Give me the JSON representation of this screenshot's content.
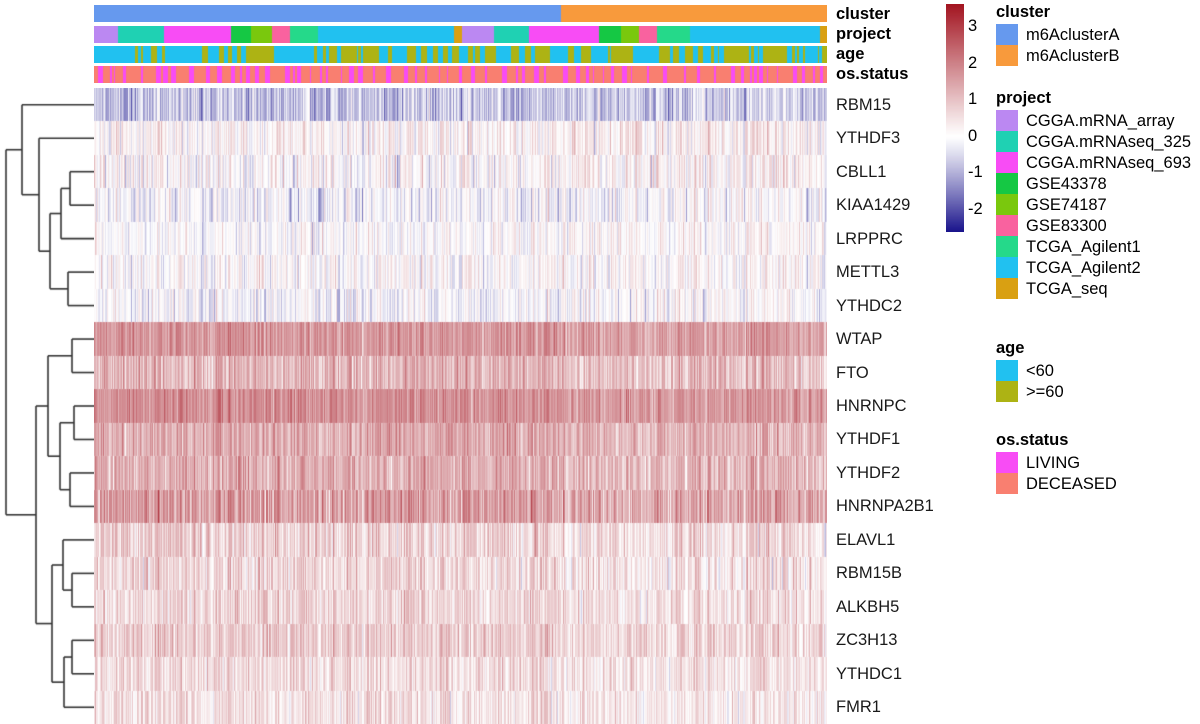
{
  "annotation_titles": [
    "cluster",
    "project",
    "age",
    "os.status"
  ],
  "row_labels": [
    "RBM15",
    "YTHDF3",
    "CBLL1",
    "KIAA1429",
    "LRPPRC",
    "METTL3",
    "YTHDC2",
    "WTAP",
    "FTO",
    "HNRNPC",
    "YTHDF1",
    "YTHDF2",
    "HNRNPA2B1",
    "ELAVL1",
    "RBM15B",
    "ALKBH5",
    "ZC3H13",
    "YTHDC1",
    "FMR1"
  ],
  "colorbar": {
    "ticks": [
      "3",
      "2",
      "1",
      "0",
      "-1",
      "-2"
    ],
    "tick_values": [
      3,
      2,
      1,
      0,
      -1,
      -2
    ],
    "vmin": -2.6,
    "vmax": 3.6,
    "low_color": "#1a148c",
    "mid_color": "#ffffff",
    "high_color": "#a31521"
  },
  "legends": [
    {
      "title": "cluster",
      "items": [
        {
          "label": "m6AclusterA",
          "color": "#6699ee"
        },
        {
          "label": "m6AclusterB",
          "color": "#f89a3c"
        }
      ]
    },
    {
      "title": "project",
      "items": [
        {
          "label": "CGGA.mRNA_array",
          "color": "#bb88f2"
        },
        {
          "label": "CGGA.mRNAseq_325",
          "color": "#1fd1b3"
        },
        {
          "label": "CGGA.mRNAseq_693",
          "color": "#f84cf5"
        },
        {
          "label": "GSE43378",
          "color": "#15c844"
        },
        {
          "label": "GSE74187",
          "color": "#7ac80d"
        },
        {
          "label": "GSE83300",
          "color": "#f9629f"
        },
        {
          "label": "TCGA_Agilent1",
          "color": "#25d98a"
        },
        {
          "label": "TCGA_Agilent2",
          "color": "#21c1f0"
        },
        {
          "label": "TCGA_seq",
          "color": "#d9a012"
        }
      ]
    },
    {
      "title": "age",
      "items": [
        {
          "label": "<60",
          "color": "#21c1f0"
        },
        {
          "label": ">=60",
          "color": "#adb314"
        }
      ]
    },
    {
      "title": "os.status",
      "items": [
        {
          "label": "LIVING",
          "color": "#f84cf5"
        },
        {
          "label": "DECEASED",
          "color": "#f97f70"
        }
      ]
    }
  ],
  "chart_data": {
    "type": "heatmap",
    "title": "",
    "xlabel": "",
    "ylabel": "",
    "colorbar_label": "",
    "rows": [
      "RBM15",
      "YTHDF3",
      "CBLL1",
      "KIAA1429",
      "LRPPRC",
      "METTL3",
      "YTHDC2",
      "WTAP",
      "FTO",
      "HNRNPC",
      "YTHDF1",
      "YTHDF2",
      "HNRNPA2B1",
      "ELAVL1",
      "RBM15B",
      "ALKBH5",
      "ZC3H13",
      "YTHDC1",
      "FMR1"
    ],
    "n_columns": 733,
    "zlim": [
      -2.6,
      3.6
    ],
    "grid": false,
    "legend_position": "right",
    "row_dendrogram": true,
    "column_dendrogram": false,
    "row_mean_values": [
      -0.75,
      0.22,
      0.1,
      -0.12,
      0.02,
      0.05,
      -0.1,
      1.55,
      1.05,
      1.7,
      1.25,
      1.2,
      1.45,
      0.62,
      0.55,
      0.58,
      0.7,
      0.48,
      0.4
    ],
    "row_spread_values": [
      0.55,
      0.55,
      0.6,
      0.55,
      0.45,
      0.5,
      0.5,
      0.42,
      0.55,
      0.42,
      0.5,
      0.5,
      0.6,
      0.55,
      0.55,
      0.5,
      0.5,
      0.5,
      0.48
    ],
    "cluster_split_column": 467,
    "column_annotations": {
      "cluster": {
        "segments": [
          {
            "label": "m6AclusterA",
            "start": 0,
            "end": 467
          },
          {
            "label": "m6AclusterB",
            "start": 467,
            "end": 733
          }
        ]
      },
      "project": {
        "segments": [
          {
            "label": "CGGA.mRNA_array",
            "start": 0,
            "end": 24
          },
          {
            "label": "CGGA.mRNAseq_325",
            "start": 24,
            "end": 70
          },
          {
            "label": "CGGA.mRNAseq_693",
            "start": 70,
            "end": 137
          },
          {
            "label": "GSE43378",
            "start": 137,
            "end": 157
          },
          {
            "label": "GSE74187",
            "start": 157,
            "end": 178
          },
          {
            "label": "GSE83300",
            "start": 178,
            "end": 196
          },
          {
            "label": "TCGA_Agilent1",
            "start": 196,
            "end": 224
          },
          {
            "label": "TCGA_Agilent2",
            "start": 224,
            "end": 360
          },
          {
            "label": "TCGA_seq",
            "start": 360,
            "end": 368
          },
          {
            "label": "CGGA.mRNA_array",
            "start": 368,
            "end": 400
          },
          {
            "label": "CGGA.mRNAseq_325",
            "start": 400,
            "end": 435
          },
          {
            "label": "CGGA.mRNAseq_693",
            "start": 435,
            "end": 505
          },
          {
            "label": "GSE43378",
            "start": 505,
            "end": 527
          },
          {
            "label": "GSE74187",
            "start": 527,
            "end": 545
          },
          {
            "label": "GSE83300",
            "start": 545,
            "end": 563
          },
          {
            "label": "TCGA_Agilent1",
            "start": 563,
            "end": 596
          },
          {
            "label": "TCGA_Agilent2",
            "start": 596,
            "end": 726
          },
          {
            "label": "TCGA_seq",
            "start": 726,
            "end": 733
          }
        ]
      },
      "age": {
        "values_legend": [
          "<60",
          ">=60"
        ],
        "pattern": "interleaved"
      },
      "os.status": {
        "values_legend": [
          "LIVING",
          "DECEASED"
        ],
        "pattern": "interleaved"
      }
    },
    "row_dendrogram_merges": [
      [
        0,
        1
      ],
      [
        2,
        3
      ],
      [
        4,
        5
      ],
      [
        6,
        7
      ],
      [
        8,
        9
      ],
      [
        10,
        11
      ],
      [
        12,
        13
      ],
      [
        14,
        15
      ],
      [
        16,
        17
      ]
    ]
  }
}
